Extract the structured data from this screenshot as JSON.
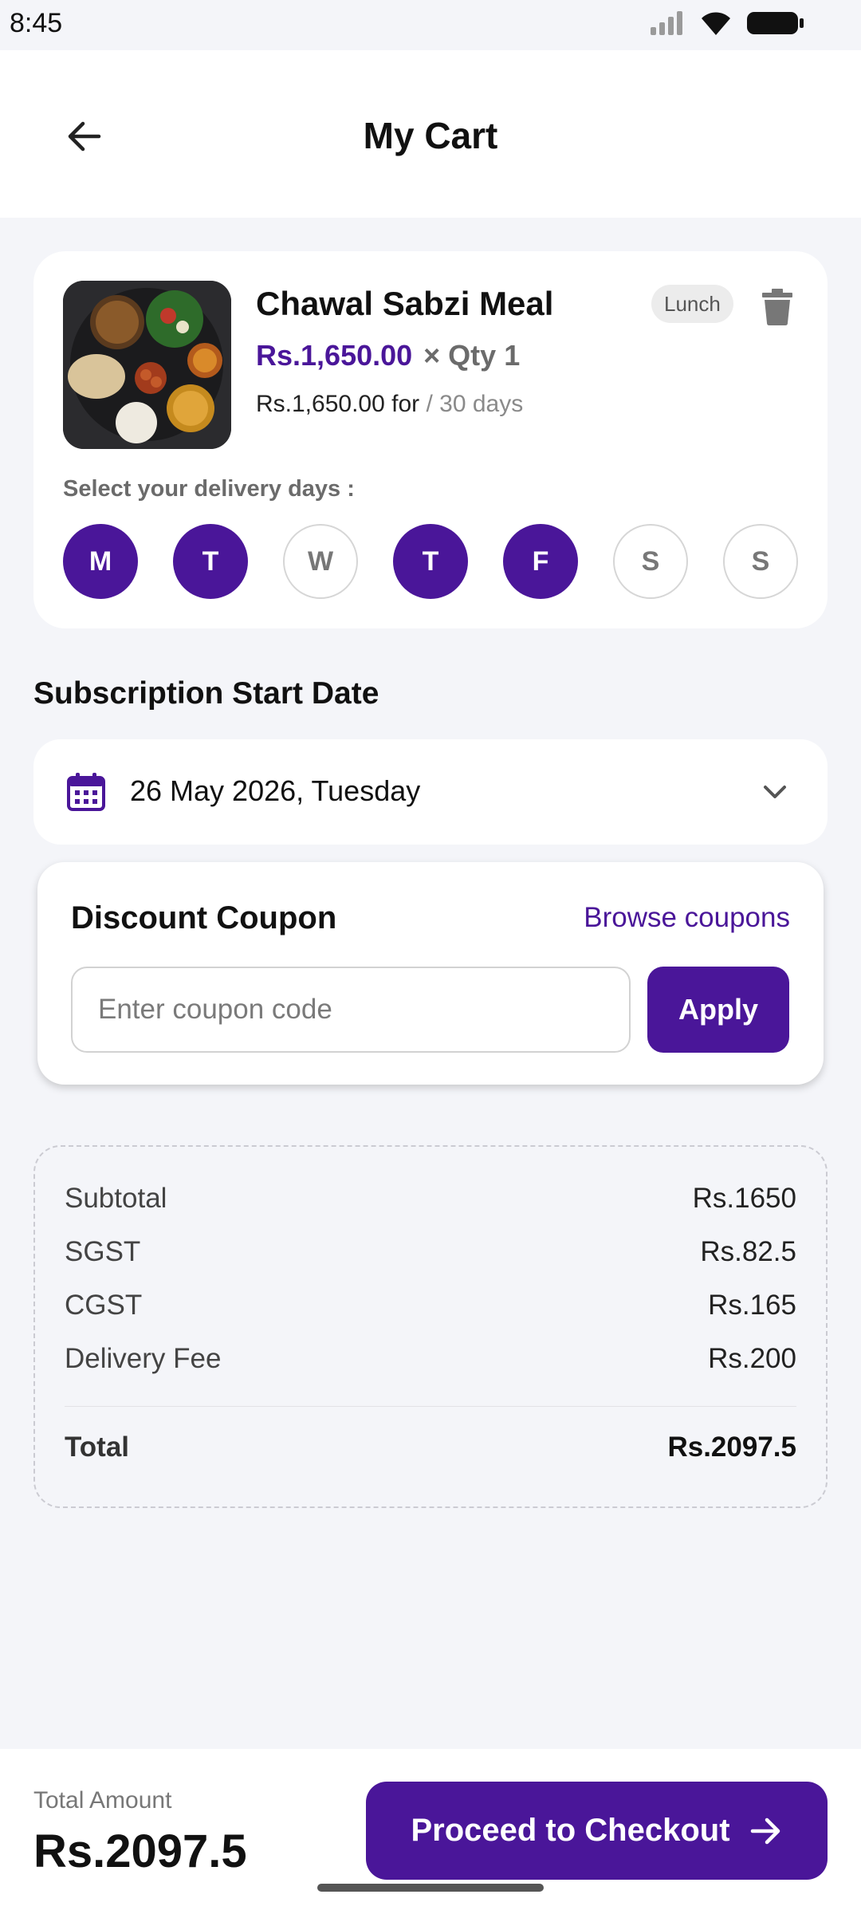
{
  "status_bar": {
    "time": "8:45"
  },
  "header": {
    "title": "My Cart"
  },
  "cart_item": {
    "name": "Chawal Sabzi Meal",
    "price": "Rs.1,650.00",
    "qty": "× Qty 1",
    "subscription_price": "Rs.1,650.00 for",
    "subscription_period": "/ 30 days",
    "meal_type": "Lunch",
    "delivery_days_label": "Select your delivery days :",
    "days": [
      {
        "label": "M",
        "selected": true
      },
      {
        "label": "T",
        "selected": true
      },
      {
        "label": "W",
        "selected": false
      },
      {
        "label": "T",
        "selected": true
      },
      {
        "label": "F",
        "selected": true
      },
      {
        "label": "S",
        "selected": false
      },
      {
        "label": "S",
        "selected": false
      }
    ]
  },
  "start_date": {
    "title": "Subscription Start Date",
    "value": "26 May 2026, Tuesday"
  },
  "coupon": {
    "title": "Discount Coupon",
    "browse_label": "Browse coupons",
    "input_placeholder": "Enter coupon code",
    "input_value": "",
    "apply_label": "Apply"
  },
  "summary": {
    "rows": [
      {
        "label": "Subtotal",
        "value": "Rs.1650"
      },
      {
        "label": "SGST",
        "value": "Rs.82.5"
      },
      {
        "label": "CGST",
        "value": "Rs.165"
      },
      {
        "label": "Delivery Fee",
        "value": "Rs.200"
      }
    ],
    "total_label": "Total",
    "total_value": "Rs.2097.5"
  },
  "bottom_bar": {
    "total_label": "Total Amount",
    "total_value": "Rs.2097.5",
    "checkout_label": "Proceed to Checkout"
  },
  "colors": {
    "accent": "#4a1699",
    "background": "#f4f5f9",
    "card": "#ffffff"
  }
}
